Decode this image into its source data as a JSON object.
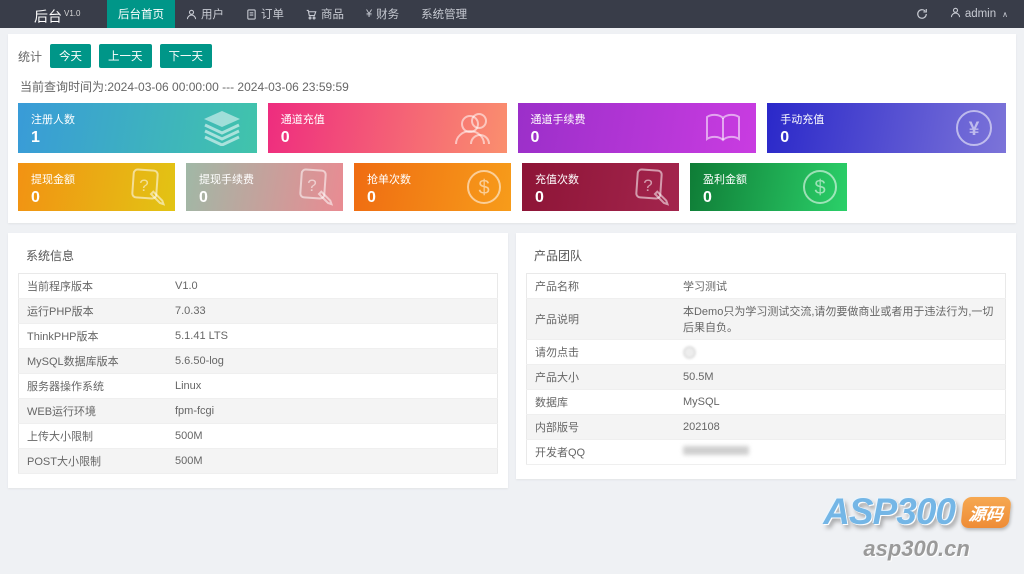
{
  "navbar": {
    "logo_text": "后台",
    "version": "V1.0",
    "items": [
      {
        "label": "后台首页",
        "icon": null,
        "active": true
      },
      {
        "label": "用户",
        "icon": "user-icon",
        "active": false
      },
      {
        "label": "订单",
        "icon": "order-icon",
        "active": false
      },
      {
        "label": "商品",
        "icon": "cart-icon",
        "active": false
      },
      {
        "label": "财务",
        "icon": "yen-text-icon",
        "active": false
      },
      {
        "label": "系统管理",
        "icon": null,
        "active": false
      }
    ],
    "user": {
      "name": "admin"
    }
  },
  "stats": {
    "label": "统计",
    "buttons": [
      "今天",
      "上一天",
      "下一天"
    ],
    "accent_color": "#009688",
    "query_time": "当前查询时间为:2024-03-06 00:00:00 --- 2024-03-06 23:59:59"
  },
  "cards_row1": [
    {
      "title": "注册人数",
      "value": "1",
      "icon": "layers-icon",
      "gradient": [
        "#399bd8",
        "#41c4ab"
      ]
    },
    {
      "title": "通道充值",
      "value": "0",
      "icon": "users-icon",
      "gradient": [
        "#ee2c7f",
        "#fa8f6e"
      ]
    },
    {
      "title": "通道手续费",
      "value": "0",
      "icon": "open-book-icon",
      "gradient": [
        "#9b2fc9",
        "#c93ce1"
      ]
    },
    {
      "title": "手动充值",
      "value": "0",
      "icon": "yen-circle-icon",
      "gradient": [
        "#2a28c9",
        "#7c74d9"
      ]
    }
  ],
  "cards_row2": [
    {
      "title": "提现金额",
      "value": "0",
      "icon": "doc-question-icon",
      "gradient": [
        "#f29213",
        "#e2c414"
      ]
    },
    {
      "title": "提现手续费",
      "value": "0",
      "icon": "doc-question-icon",
      "gradient": [
        "#a0b8a6",
        "#e98b92"
      ]
    },
    {
      "title": "抢单次数",
      "value": "0",
      "icon": "dollar-circle-icon",
      "gradient": [
        "#ef6c12",
        "#f79c1a"
      ]
    },
    {
      "title": "充值次数",
      "value": "0",
      "icon": "doc-question-icon",
      "gradient": [
        "#8d1436",
        "#a3254d"
      ]
    },
    {
      "title": "盈利金额",
      "value": "0",
      "icon": "dollar-circle-icon",
      "gradient": [
        "#0f7c36",
        "#2bd069"
      ]
    }
  ],
  "system_info": {
    "title": "系统信息",
    "rows": [
      {
        "label": "当前程序版本",
        "value": "V1.0"
      },
      {
        "label": "运行PHP版本",
        "value": "7.0.33"
      },
      {
        "label": "ThinkPHP版本",
        "value": "5.1.41 LTS"
      },
      {
        "label": "MySQL数据库版本",
        "value": "5.6.50-log"
      },
      {
        "label": "服务器操作系统",
        "value": "Linux"
      },
      {
        "label": "WEB运行环境",
        "value": "fpm-fcgi"
      },
      {
        "label": "上传大小限制",
        "value": "500M"
      },
      {
        "label": "POST大小限制",
        "value": "500M"
      }
    ]
  },
  "product_team": {
    "title": "产品团队",
    "rows": [
      {
        "label": "产品名称",
        "value": "学习测试"
      },
      {
        "label": "产品说明",
        "value": "本Demo只为学习测试交流,请勿要做商业或者用于违法行为,一切后果自负。"
      },
      {
        "label": "请勿点击",
        "value": "",
        "masked": "icon"
      },
      {
        "label": "产品大小",
        "value": "50.5M"
      },
      {
        "label": "数据库",
        "value": "MySQL"
      },
      {
        "label": "内部版号",
        "value": "202108"
      },
      {
        "label": "开发者QQ",
        "value": "",
        "masked": "text"
      }
    ]
  },
  "watermark": {
    "brand": "ASP300",
    "badge": "源码",
    "domain": "asp300.cn"
  }
}
